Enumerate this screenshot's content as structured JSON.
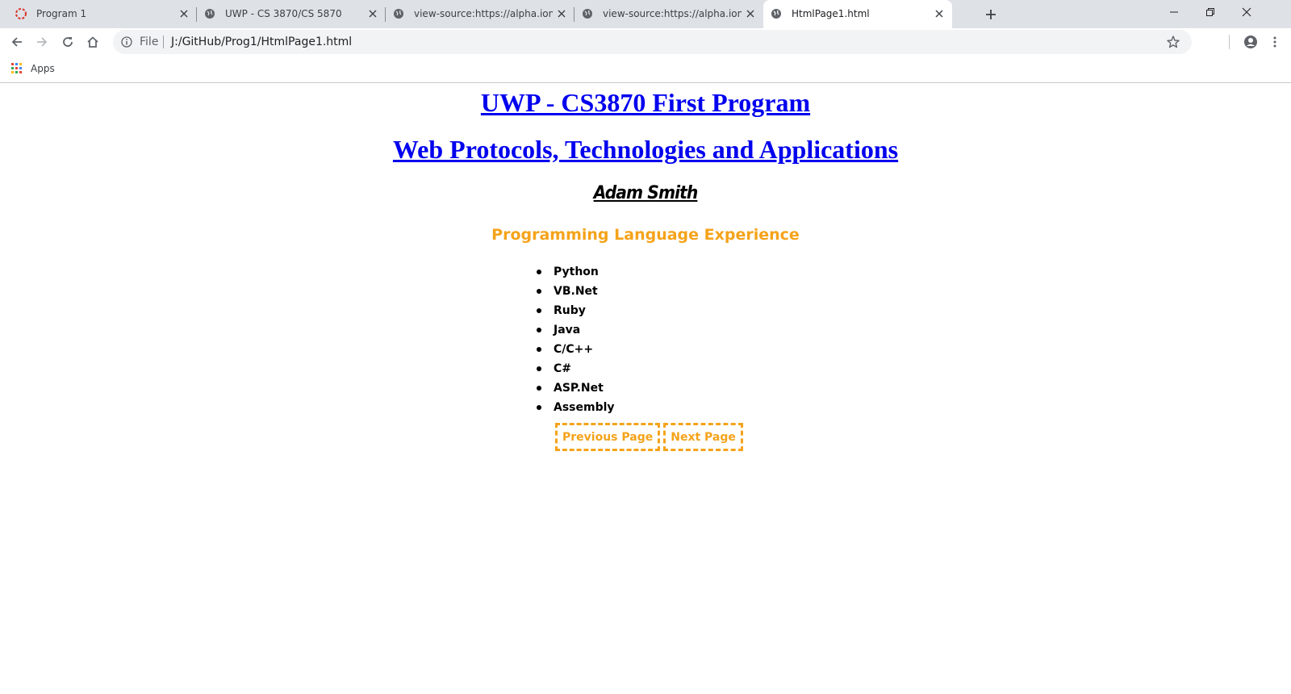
{
  "browser": {
    "tabs": [
      {
        "title": "Program 1",
        "icon": "loading-spinner-icon",
        "active": false
      },
      {
        "title": "UWP - CS 3870/CS 5870",
        "icon": "globe-icon",
        "active": false
      },
      {
        "title": "view-source:https://alpha.ion.uwplatt",
        "icon": "globe-icon",
        "active": false
      },
      {
        "title": "view-source:https://alpha.ion.uwplatt",
        "icon": "globe-icon",
        "active": false
      },
      {
        "title": "HtmlPage1.html",
        "icon": "globe-icon",
        "active": true
      }
    ],
    "omnibox": {
      "scheme_label": "File",
      "url": "J:/GitHub/Prog1/HtmlPage1.html"
    },
    "bookmarks": {
      "apps_label": "Apps"
    },
    "colors": {
      "tab_strip": "#dee1e6",
      "omnibox_bg": "#f1f3f4"
    }
  },
  "page": {
    "heading1": "UWP - CS3870 First Program",
    "heading2": "Web Protocols, Technologies and Applications",
    "author": "Adam Smith",
    "section_title": "Programming Language Experience",
    "languages": [
      "Python",
      "VB.Net",
      "Ruby",
      "Java",
      "C/C++",
      "C#",
      "ASP.Net",
      "Assembly"
    ],
    "nav": {
      "previous_label": "Previous Page",
      "next_label": "Next Page"
    },
    "colors": {
      "link": "#0000ee",
      "accent_orange": "#f5a31a"
    }
  }
}
